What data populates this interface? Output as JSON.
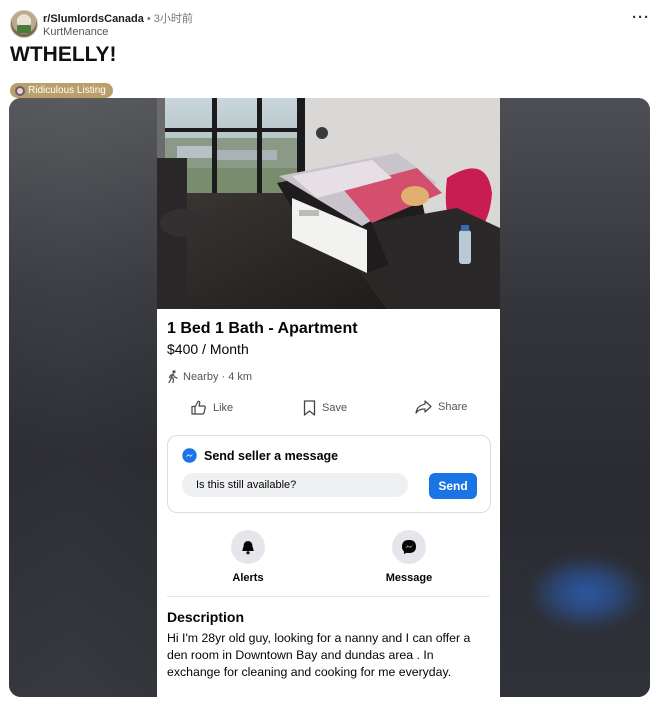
{
  "post": {
    "subreddit": "r/SlumlordsCanada",
    "separator": "•",
    "time_ago": "3小时前",
    "author": "KurtMenance",
    "title": "WTHELLY!",
    "flair": "Ridiculous Listing",
    "more_icon": "more-horizontal-icon"
  },
  "listing": {
    "title": "1 Bed 1 Bath - Apartment",
    "price": "$400 / Month",
    "nearby": "Nearby · 4 km",
    "actions": {
      "like": "Like",
      "save": "Save",
      "share": "Share"
    },
    "message_box": {
      "heading": "Send seller a message",
      "input_value": "Is this still available?",
      "send_label": "Send"
    },
    "quick_actions": {
      "alerts": "Alerts",
      "message": "Message"
    },
    "description": {
      "heading": "Description",
      "text": "Hi I'm 28yr old guy, looking for a nanny and I can offer a den room in Downtown Bay and dundas area . In exchange for cleaning and cooking for me everyday."
    }
  },
  "colors": {
    "facebook_blue": "#1b74e4",
    "flair_bg": "#b9a06a",
    "media_bg": "#2a2b30"
  }
}
